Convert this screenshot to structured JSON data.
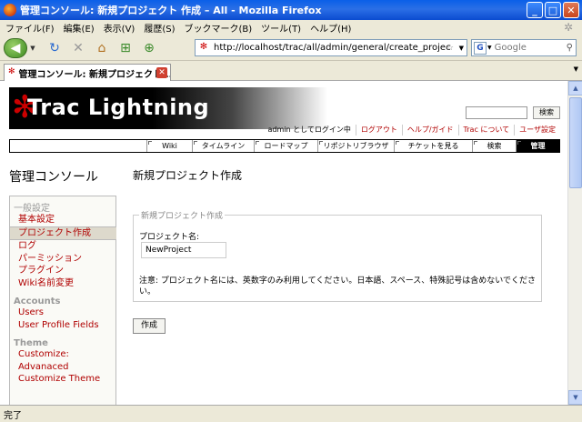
{
  "window": {
    "title": "管理コンソール: 新規プロジェクト 作成 – All - Mozilla Firefox",
    "buttons": {
      "minimize": "_",
      "maximize": "□",
      "close": "✕"
    }
  },
  "menu": [
    "ファイル(F)",
    "編集(E)",
    "表示(V)",
    "履歴(S)",
    "ブックマーク(B)",
    "ツール(T)",
    "ヘルプ(H)"
  ],
  "toolbar": {
    "url": "http://localhost/trac/all/admin/general/create_project",
    "search_placeholder": "Google"
  },
  "tab": {
    "label": "管理コンソール: 新規プロジェクト..."
  },
  "status": "完了",
  "trac": {
    "logo": "Trac Lightning",
    "search_button": "検索",
    "metanav": {
      "logged_in": "admin としてログイン中",
      "logout": "ログアウト",
      "help": "ヘルプ/ガイド",
      "about": "Trac について",
      "prefs": "ユーザ設定"
    },
    "mainnav": [
      "Wiki",
      "タイムライン",
      "ロードマップ",
      "リポジトリブラウザ",
      "チケットを見る",
      "検索",
      "管理"
    ],
    "admin_title": "管理コンソール",
    "page_title": "新規プロジェクト作成",
    "sidebar": {
      "general": {
        "heading": "一般設定",
        "items": [
          "基本設定",
          "プロジェクト作成",
          "ログ",
          "パーミッション",
          "プラグイン",
          "Wiki名前変更"
        ]
      },
      "accounts": {
        "heading": "Accounts",
        "items": [
          "Users",
          "User Profile Fields"
        ]
      },
      "theme": {
        "heading": "Theme",
        "items": [
          "Customize: Advanaced",
          "Customize Theme"
        ]
      }
    },
    "form": {
      "legend": "新規プロジェクト作成",
      "name_label": "プロジェクト名:",
      "name_value": "NewProject",
      "note": "注意: プロジェクト名には、英数字のみ利用してください。日本語、スペース、特殊記号は含めないでください。",
      "submit": "作成"
    }
  }
}
